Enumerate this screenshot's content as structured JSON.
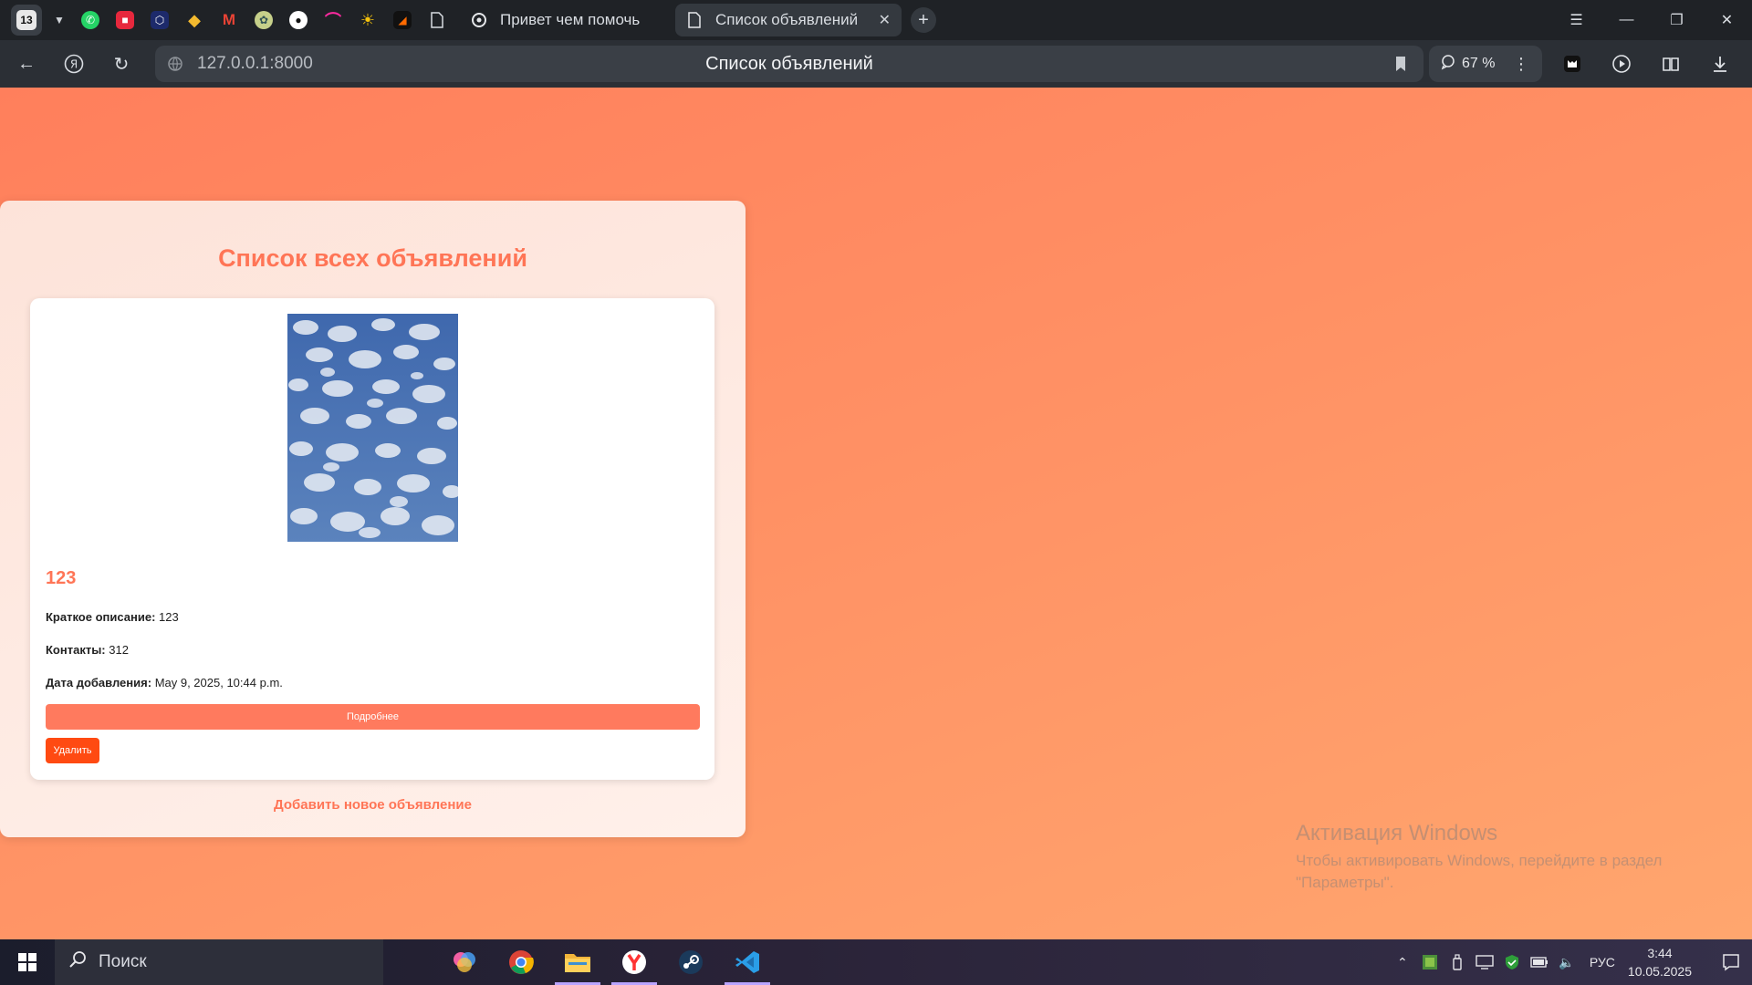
{
  "browser": {
    "tab_count": "13",
    "tabs": [
      {
        "title": "Привет чем помочь",
        "active": false
      },
      {
        "title": "Список объявлений",
        "active": true
      }
    ],
    "url": "127.0.0.1:8000",
    "page_title": "Список объявлений",
    "zoom": "67 %"
  },
  "page": {
    "heading": "Список всех объявлений",
    "ads": [
      {
        "title": "123",
        "short_description_label": "Краткое описание:",
        "short_description": "123",
        "contacts_label": "Контакты:",
        "contacts": "312",
        "date_label": "Дата добавления:",
        "date": "May 9, 2025, 10:44 p.m.",
        "details_button": "Подробнее",
        "delete_button": "Удалить"
      }
    ],
    "add_link": "Добавить новое объявление"
  },
  "watermark": {
    "title": "Активация Windows",
    "text": "Чтобы активировать Windows, перейдите в раздел \"Параметры\"."
  },
  "taskbar": {
    "search_placeholder": "Поиск",
    "language": "РУС",
    "time": "3:44",
    "date": "10.05.2025"
  },
  "colors": {
    "accent": "#ff7556",
    "details_button": "#ff7a5e",
    "delete_button": "#ff4a12"
  }
}
